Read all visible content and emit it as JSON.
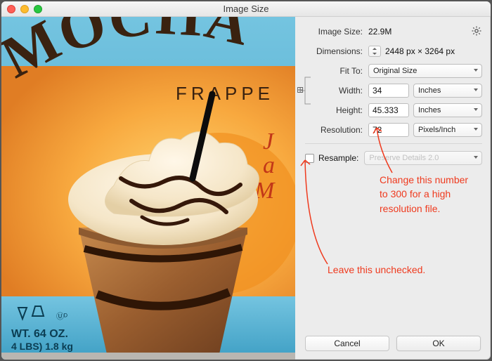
{
  "window": {
    "title": "Image Size"
  },
  "labels": {
    "image_size": "Image Size:",
    "dimensions": "Dimensions:",
    "fit_to": "Fit To:",
    "width": "Width:",
    "height": "Height:",
    "resolution": "Resolution:",
    "resample": "Resample:"
  },
  "values": {
    "image_size": "22.9M",
    "dimensions": "2448 px  ×  3264 px",
    "fit_to": "Original Size",
    "width": "34",
    "width_unit": "Inches",
    "height": "45.333",
    "height_unit": "Inches",
    "resolution": "72",
    "resolution_unit": "Pixels/Inch",
    "resample_method": "Preserve Details 2.0",
    "resample_checked": false
  },
  "buttons": {
    "cancel": "Cancel",
    "ok": "OK"
  },
  "annotations": {
    "a1": "Change this number to 300 for a high resolution file.",
    "a2": "Leave this unchecked."
  }
}
